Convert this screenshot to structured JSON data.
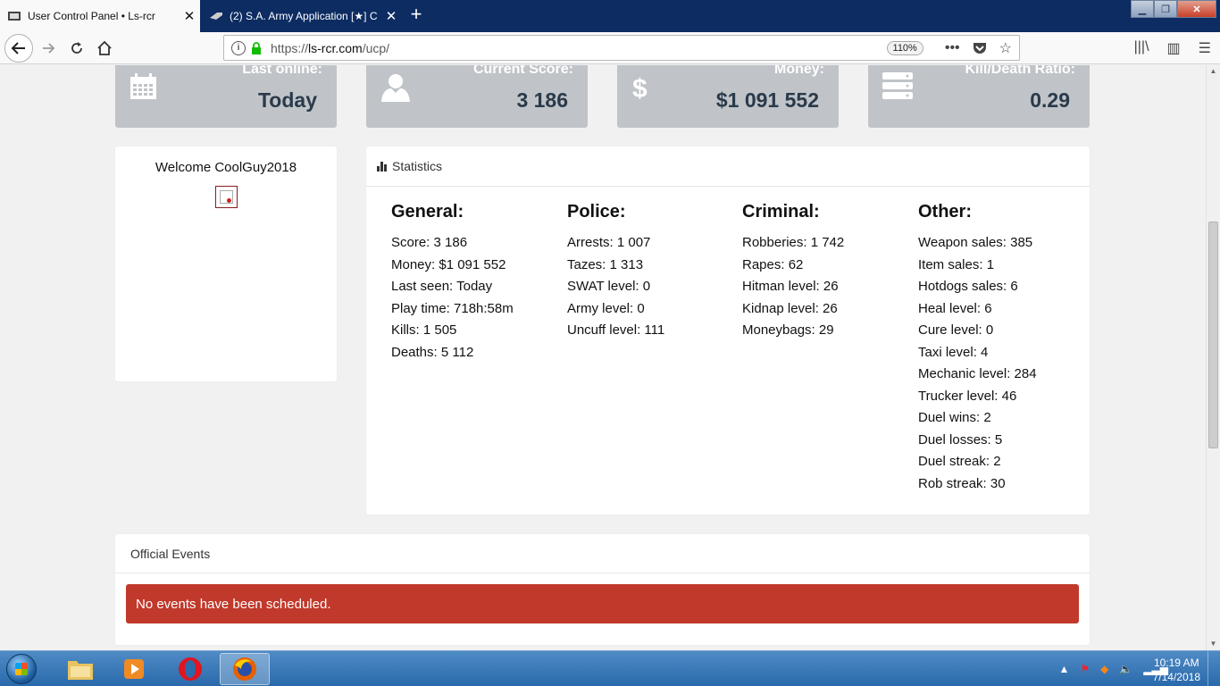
{
  "browser": {
    "tabs": [
      {
        "title": "User Control Panel • Ls-rcr",
        "active": true
      },
      {
        "title": "(2) S.A. Army Application [★] C",
        "active": false
      }
    ],
    "url_prefix": "https://",
    "url_host": "ls-rcr.com",
    "url_path": "/ucp/",
    "zoom": "110%",
    "close_glyph": "✕",
    "newtab_glyph": "+"
  },
  "top_stats": [
    {
      "label": "Last online:",
      "value": "Today",
      "icon": "calendar-icon"
    },
    {
      "label": "Current Score:",
      "value": "3 186",
      "icon": "user-icon"
    },
    {
      "label": "Money:",
      "value": "$1 091 552",
      "icon": "dollar-icon"
    },
    {
      "label": "Kill/Death Ratio:",
      "value": "0.29",
      "icon": "server-icon"
    }
  ],
  "welcome": {
    "text": "Welcome CoolGuy2018"
  },
  "statistics": {
    "title": "Statistics",
    "general": {
      "heading": "General:",
      "items": [
        "Score: 3 186",
        "Money: $1 091 552",
        "Last seen: Today",
        "Play time: 718h:58m",
        "Kills: 1 505",
        "Deaths: 5 112"
      ]
    },
    "police": {
      "heading": "Police:",
      "items": [
        "Arrests: 1 007",
        "Tazes: 1 313",
        "SWAT level: 0",
        "Army level: 0",
        "Uncuff level: 111"
      ]
    },
    "criminal": {
      "heading": "Criminal:",
      "items": [
        "Robberies: 1 742",
        "Rapes: 62",
        "Hitman level: 26",
        "Kidnap level: 26",
        "Moneybags: 29"
      ]
    },
    "other": {
      "heading": "Other:",
      "items": [
        "Weapon sales: 385",
        "Item sales: 1",
        "Hotdogs sales: 6",
        "Heal level: 6",
        "Cure level: 0",
        "Taxi level: 4",
        "Mechanic level: 284",
        "Trucker level: 46",
        "Duel wins: 2",
        "Duel losses: 5",
        "Duel streak: 2",
        "Rob streak: 30"
      ]
    }
  },
  "events": {
    "title": "Official Events",
    "message": "No events have been scheduled."
  },
  "taskbar": {
    "time": "10:19 AM",
    "date": "7/14/2018"
  },
  "colors": {
    "accent_alert": "#c0392b",
    "stat_box": "#c0c4c8",
    "tabbar": "#0c2c62"
  }
}
